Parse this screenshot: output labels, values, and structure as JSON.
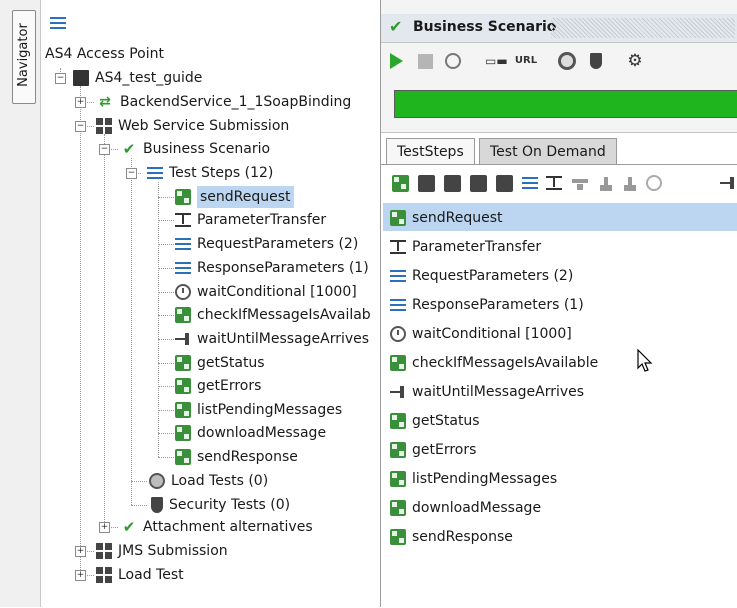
{
  "navigator": {
    "tab_label": "Navigator"
  },
  "tree": {
    "root": "AS4 Access Point",
    "project": "AS4_test_guide",
    "binding": "BackendService_1_1SoapBinding",
    "testsuite": "Web Service Submission",
    "testcase": "Business Scenario",
    "teststeps_group": "Test Steps (12)",
    "steps": [
      "sendRequest",
      "ParameterTransfer",
      "RequestParameters (2)",
      "ResponseParameters (1)",
      "waitConditional [1000]",
      "checkIfMessageIsAvailab",
      "waitUntilMessageArrives",
      "getStatus",
      "getErrors",
      "listPendingMessages",
      "downloadMessage",
      "sendResponse"
    ],
    "load_tests": "Load Tests (0)",
    "security_tests": "Security Tests (0)",
    "attachment": "Attachment alternatives",
    "jms": "JMS Submission",
    "load_test": "Load Test"
  },
  "right_panel": {
    "title": "Business Scenario",
    "url_label": "URL",
    "progress_percent": 100,
    "progress_color": "#1fb51f",
    "tabs": [
      "TestSteps",
      "Test On Demand"
    ],
    "steps": [
      "sendRequest",
      "ParameterTransfer",
      "RequestParameters (2)",
      "ResponseParameters (1)",
      "waitConditional [1000]",
      "checkIfMessageIsAvailable",
      "waitUntilMessageArrives",
      "getStatus",
      "getErrors",
      "listPendingMessages",
      "downloadMessage",
      "sendResponse"
    ]
  },
  "colors": {
    "selection": "#bcd6f1",
    "accent_green": "#2e9b2e"
  }
}
